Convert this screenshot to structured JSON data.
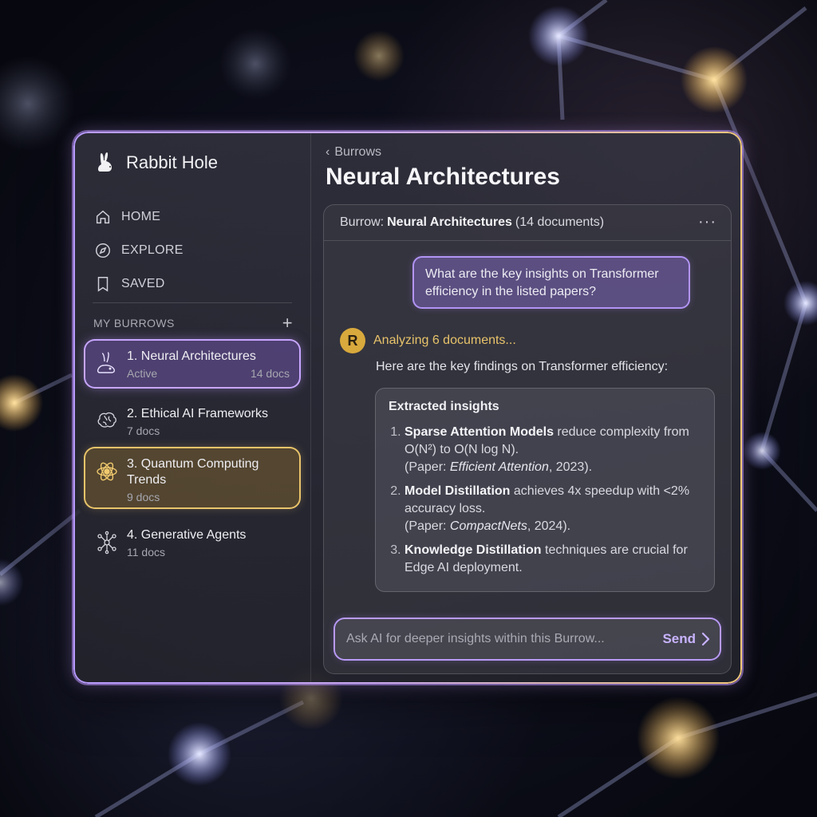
{
  "app": {
    "name": "Rabbit Hole"
  },
  "nav": [
    {
      "label": "HOME",
      "icon": "home-icon"
    },
    {
      "label": "EXPLORE",
      "icon": "compass-icon"
    },
    {
      "label": "SAVED",
      "icon": "bookmark-icon"
    }
  ],
  "sidebar": {
    "section_title": "MY BURROWS",
    "add_symbol": "+",
    "burrows": [
      {
        "title": "1. Neural Architectures",
        "status": "Active",
        "count": "14 docs",
        "icon": "rabbit-icon"
      },
      {
        "title": "2. Ethical AI Frameworks",
        "status": "",
        "count": "7 docs",
        "icon": "brain-icon"
      },
      {
        "title": "3. Quantum Computing Trends",
        "status": "",
        "count": "9 docs",
        "icon": "atom-icon"
      },
      {
        "title": "4. Generative Agents",
        "status": "",
        "count": "11 docs",
        "icon": "network-icon"
      }
    ]
  },
  "main": {
    "back_label": "Burrows",
    "title": "Neural Architectures",
    "card_header": {
      "prefix": "Burrow:",
      "name": "Neural Architectures",
      "count": "(14 documents)",
      "more": "···"
    },
    "user_message": "What are the key insights on Transformer efficiency in the listed papers?",
    "ai": {
      "avatar": "R",
      "status": "Analyzing 6 documents...",
      "intro": "Here are the key findings on Transformer efficiency:",
      "insights_title": "Extracted insights",
      "insights": [
        {
          "bold": "Sparse Attention Models",
          "text": " reduce complexity from O(N²) to O(N log N).",
          "paper_prefix": "(Paper: ",
          "paper": "Efficient Attention",
          "paper_suffix": ", 2023)."
        },
        {
          "bold": "Model Distillation",
          "text": " achieves 4x speedup with <2% accuracy loss.",
          "paper_prefix": "(Paper: ",
          "paper": "CompactNets",
          "paper_suffix": ", 2024)."
        },
        {
          "bold": "Knowledge Distillation",
          "text": " techniques are crucial for Edge AI deployment."
        }
      ]
    },
    "composer": {
      "placeholder": "Ask AI for deeper insights within this Burrow...",
      "send_label": "Send"
    }
  },
  "colors": {
    "accent_purple": "#b99af7",
    "accent_gold": "#e9c46a",
    "avatar_gold": "#d8a93c"
  }
}
